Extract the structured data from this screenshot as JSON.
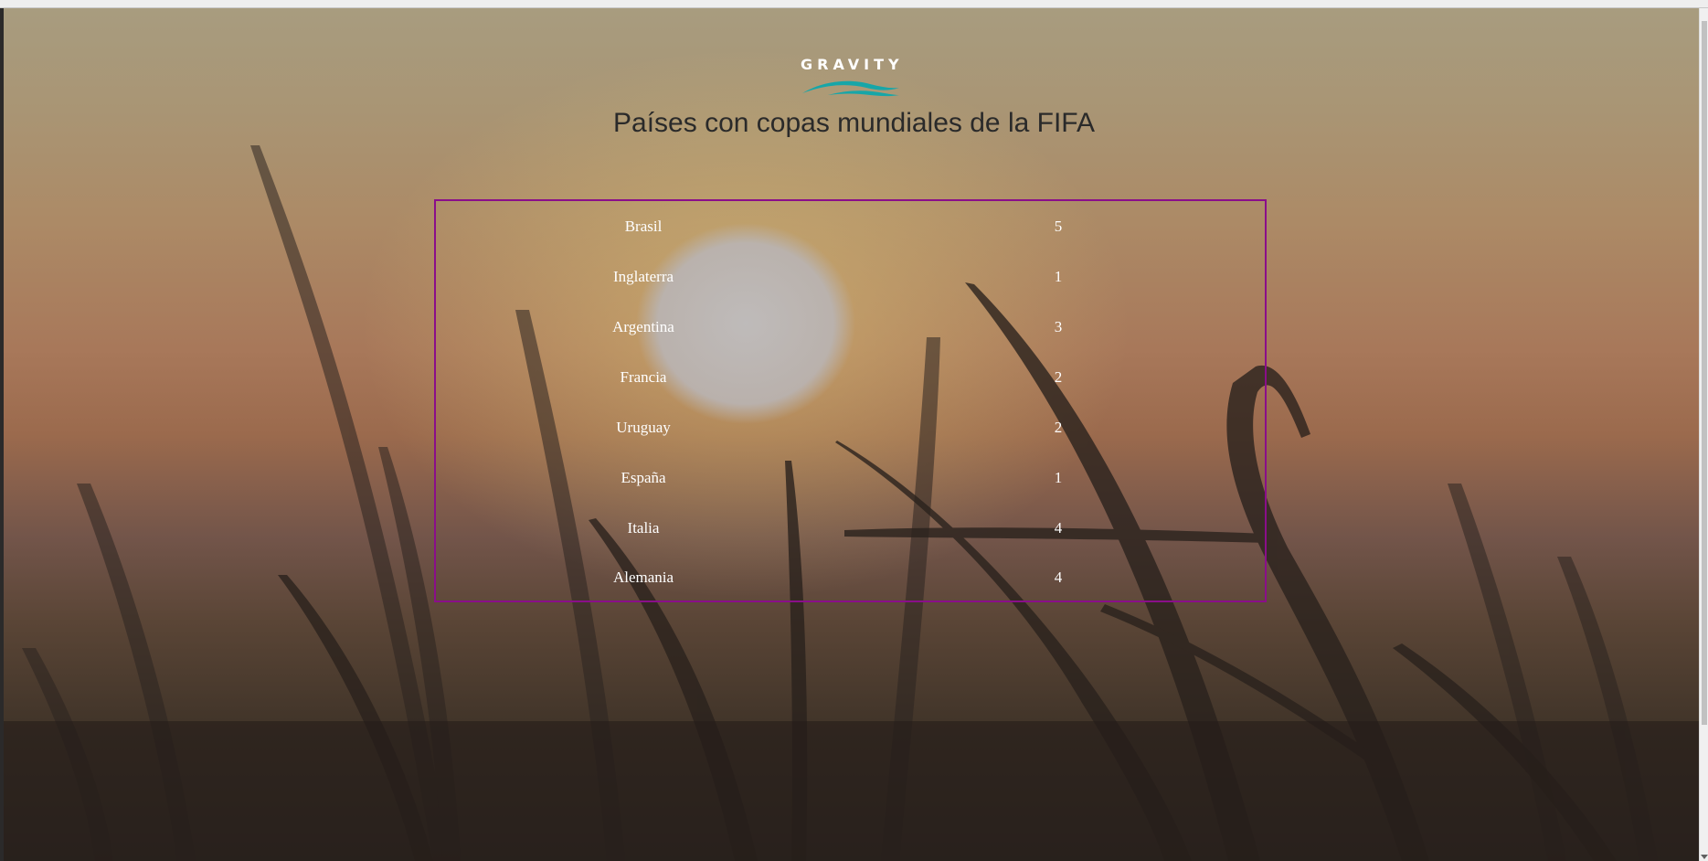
{
  "logo": {
    "text": "GRAVITY",
    "wave_color": "#17a6a8"
  },
  "page": {
    "title": "Países con copas mundiales de la FIFA"
  },
  "colors": {
    "table_border": "#8a0e8a",
    "cell_text": "#ffffff",
    "title_text": "#2a2a2a"
  },
  "table": {
    "rows": [
      {
        "country": "Brasil",
        "cups": "5"
      },
      {
        "country": "Inglaterra",
        "cups": "1"
      },
      {
        "country": "Argentina",
        "cups": "3"
      },
      {
        "country": "Francia",
        "cups": "2"
      },
      {
        "country": "Uruguay",
        "cups": "2"
      },
      {
        "country": "España",
        "cups": "1"
      },
      {
        "country": "Italia",
        "cups": "4"
      },
      {
        "country": "Alemania",
        "cups": "4"
      }
    ]
  }
}
